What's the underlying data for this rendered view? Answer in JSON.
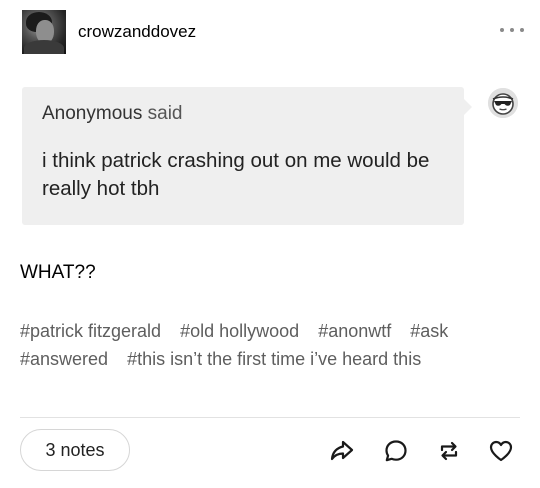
{
  "post": {
    "username": "crowzanddovez",
    "ask": {
      "asker_name": "Anonymous",
      "asker_verb": "said",
      "question": "i think patrick crashing out on me would be really hot tbh"
    },
    "answer": "WHAT??",
    "tags": [
      "#patrick fitzgerald",
      "#old hollywood",
      "#anonwtf",
      "#ask",
      "#answered",
      "#this isn’t the first time i’ve heard this"
    ],
    "notes_label": "3 notes"
  },
  "icons": {
    "more": "more-dots-icon",
    "share": "share-arrow-icon",
    "reply": "reply-bubble-icon",
    "reblog": "reblog-icon",
    "like": "heart-icon",
    "anon": "anonymous-sunglasses-icon"
  },
  "colors": {
    "ask_background": "#efefef",
    "tag_text": "#5e5e5e",
    "icon": "#1a1a1a"
  }
}
